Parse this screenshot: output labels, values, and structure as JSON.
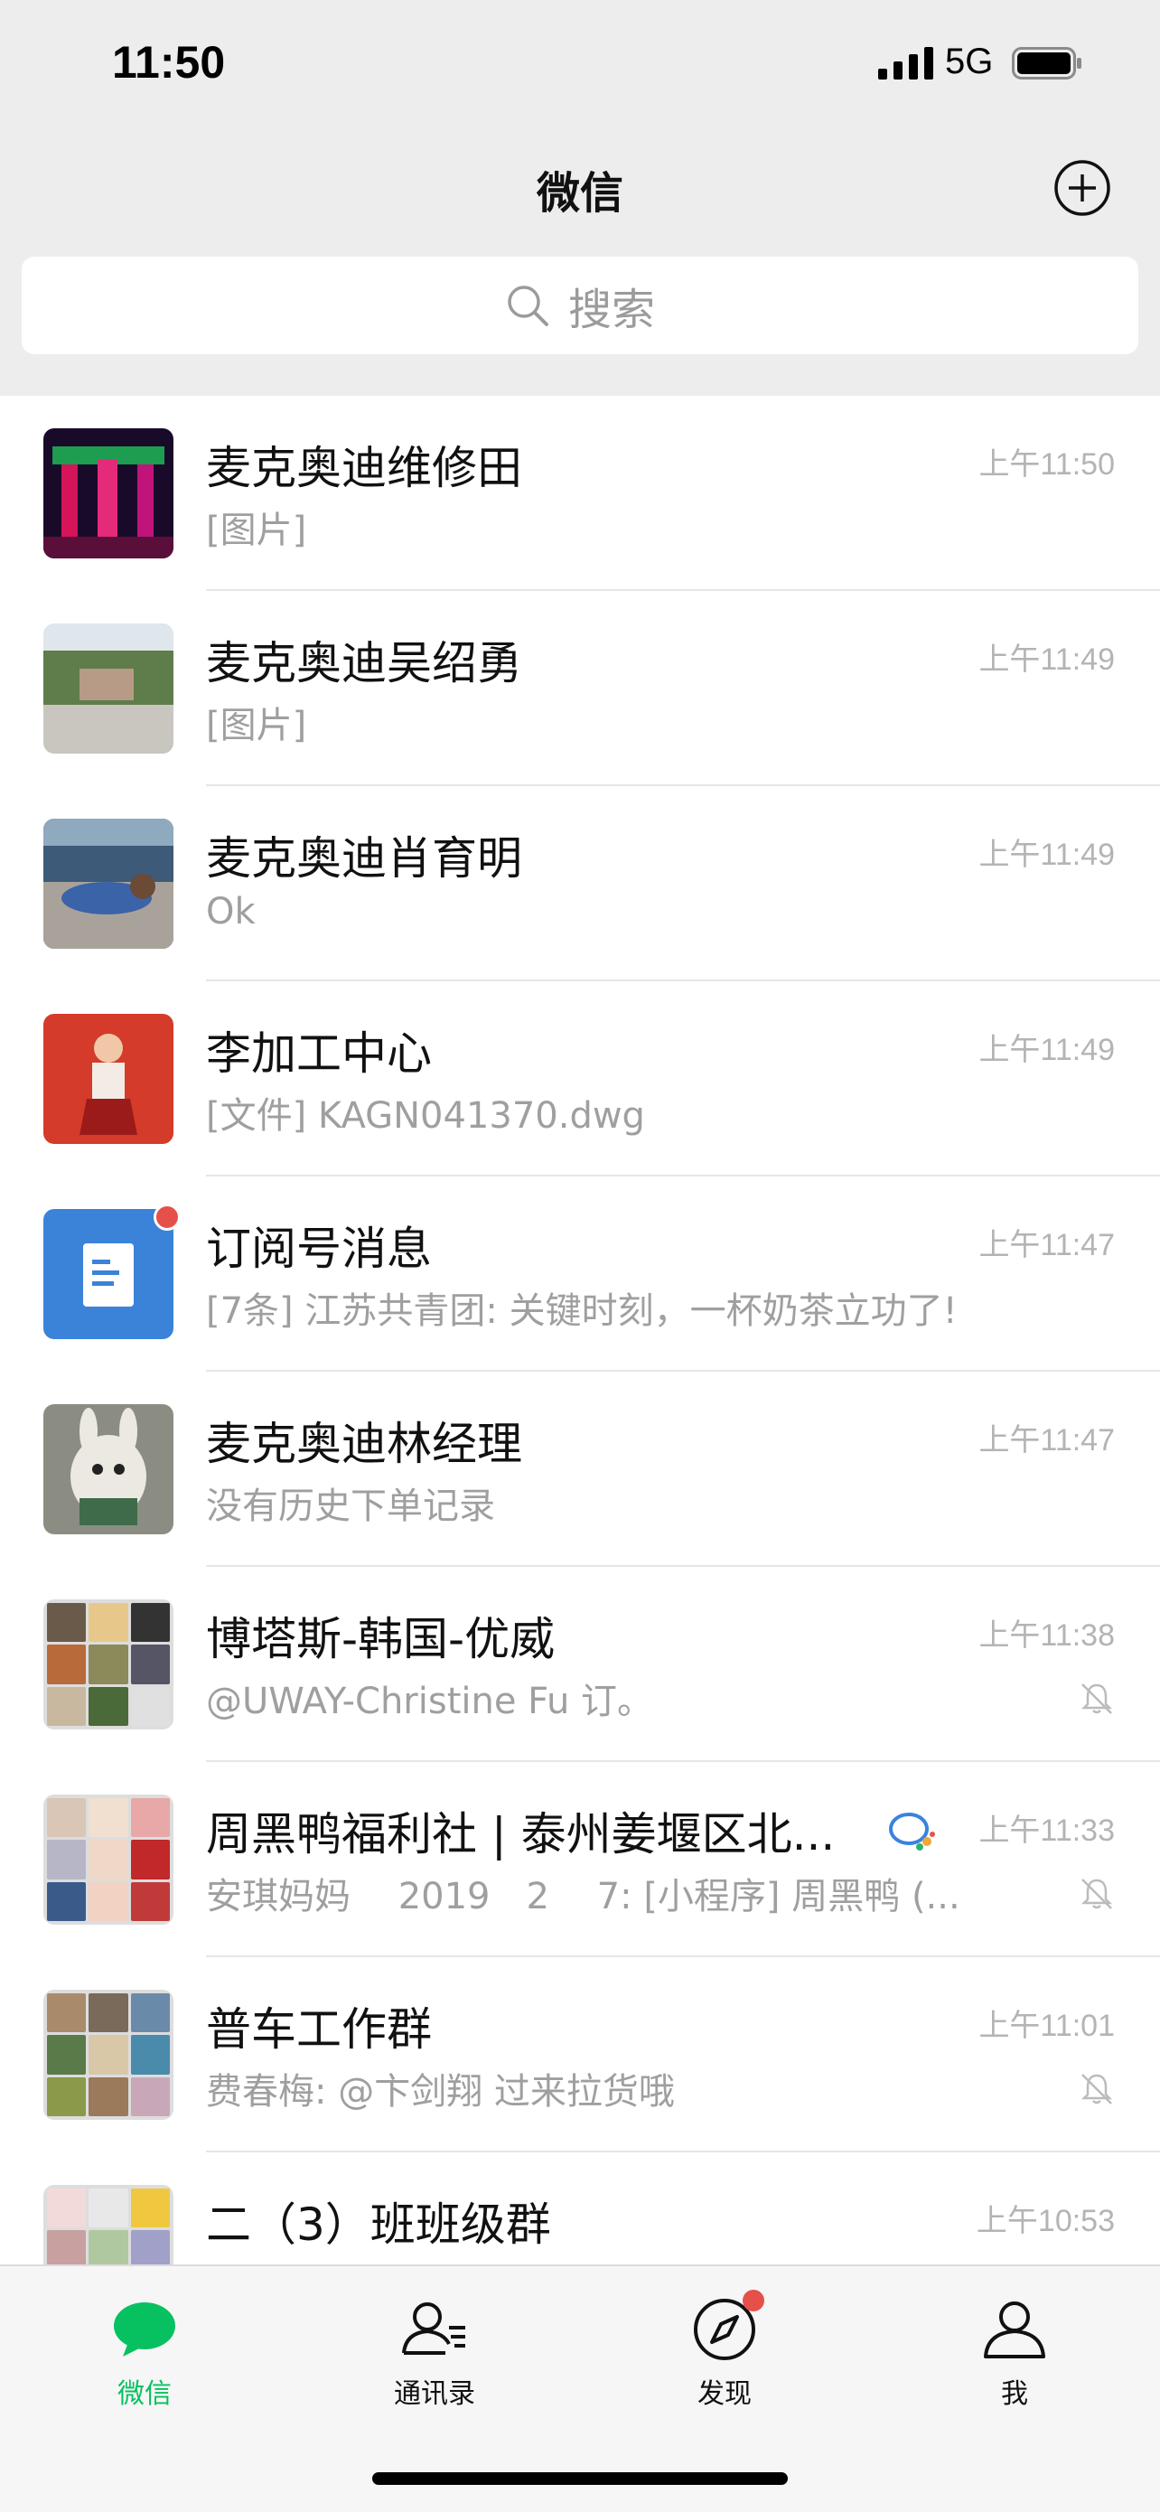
{
  "status_bar": {
    "time": "11:50",
    "network": "5G"
  },
  "header": {
    "title": "微信"
  },
  "search": {
    "placeholder": "搜索"
  },
  "chats": [
    {
      "name": "麦克奥迪维修田",
      "preview": "[图片]",
      "time": "上午11:50"
    },
    {
      "name": "麦克奥迪吴绍勇",
      "preview": "[图片]",
      "time": "上午11:49"
    },
    {
      "name": "麦克奥迪肖育明",
      "preview": "Ok",
      "time": "上午11:49"
    },
    {
      "name": "李加工中心",
      "preview": "[文件] KAGN041370.dwg",
      "time": "上午11:49"
    },
    {
      "name": "订阅号消息",
      "preview": "[7条] 江苏共青团: 关键时刻，一杯奶茶立功了!",
      "time": "上午11:47"
    },
    {
      "name": "麦克奥迪林经理",
      "preview": "没有历史下单记录",
      "time": "上午11:47"
    },
    {
      "name": "博塔斯-韩国-优威",
      "preview": "@UWAY-Christine Fu 订。",
      "time": "上午11:38",
      "muted": true
    },
    {
      "name": "周黑鸭福利社 | 泰州姜堰区北...",
      "preview": "安琪妈妈　 2019　2　 7: [小程序] 周黑鸭 (...",
      "time": "上午11:33",
      "muted": true
    },
    {
      "name": "普车工作群",
      "preview": "费春梅: @卞剑翔 过来拉货哦",
      "time": "上午11:01",
      "muted": true
    },
    {
      "name": "二（3）班班级群",
      "preview": "",
      "time": "上午10:53"
    }
  ],
  "tabs": [
    {
      "label": "微信",
      "icon": "chat-bubble-icon",
      "active": true
    },
    {
      "label": "通讯录",
      "icon": "contacts-icon"
    },
    {
      "label": "发现",
      "icon": "compass-icon",
      "badge": true
    },
    {
      "label": "我",
      "icon": "person-icon"
    }
  ],
  "colors": {
    "accent": "#07c160",
    "badge": "#e5514a",
    "background": "#ededed"
  }
}
